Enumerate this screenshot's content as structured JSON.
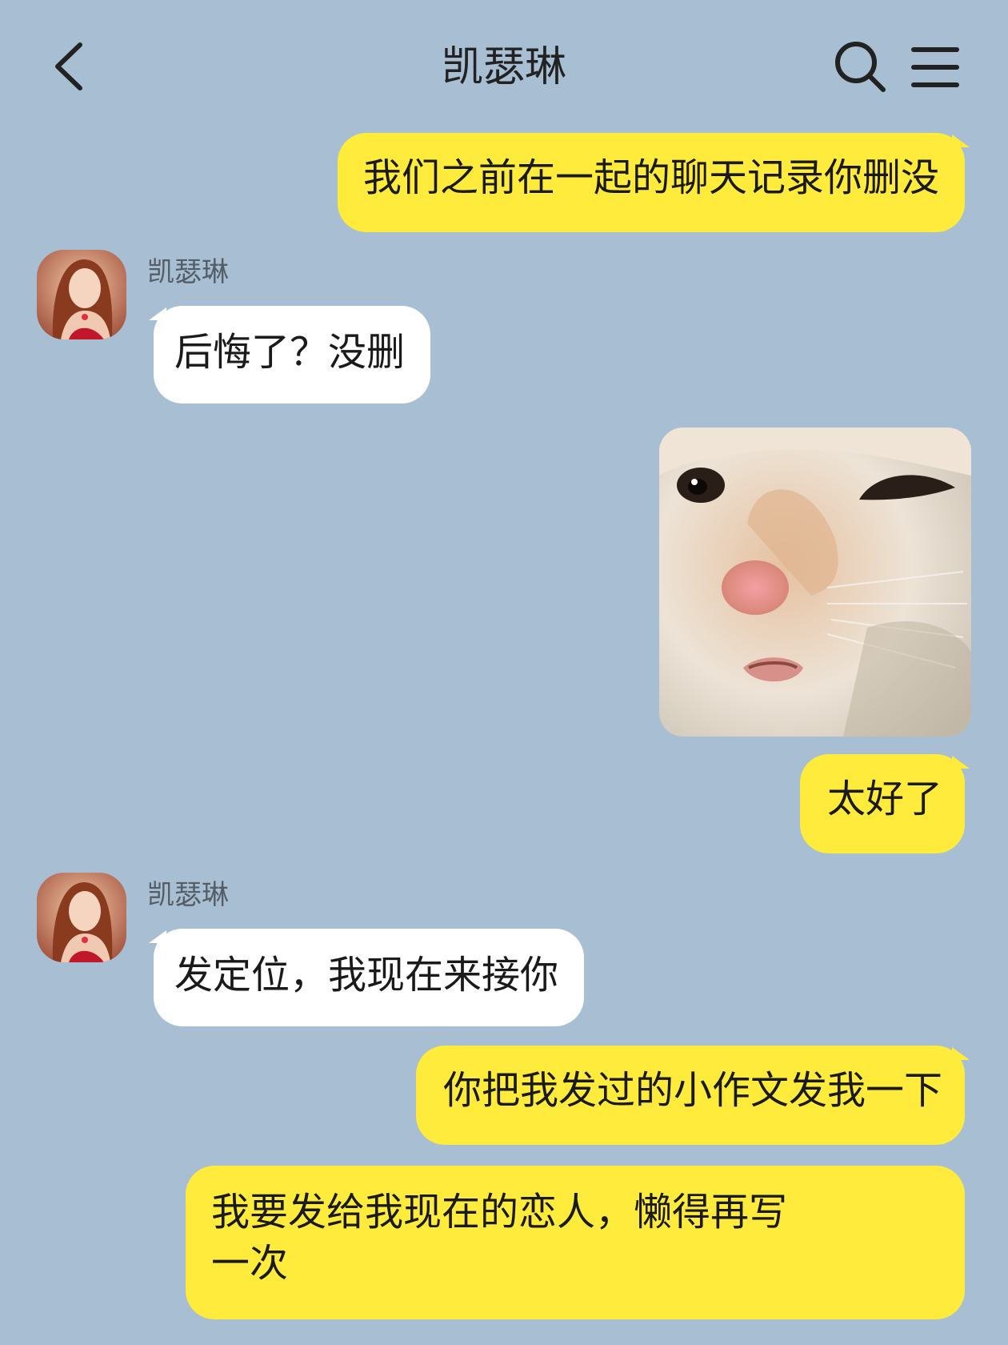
{
  "header": {
    "title": "凯瑟琳",
    "back_icon": "chevron-left-icon",
    "search_icon": "search-icon",
    "menu_icon": "hamburger-menu-icon"
  },
  "messages": [
    {
      "sender": "me",
      "text": "我们之前在一起的聊天记录你删没"
    },
    {
      "sender": "them",
      "name": "凯瑟琳",
      "text": "后悔了？没删"
    },
    {
      "sender": "me",
      "type": "sticker",
      "sticker": "cat-face-sticker"
    },
    {
      "sender": "me",
      "text": "太好了"
    },
    {
      "sender": "them",
      "name": "凯瑟琳",
      "text": "发定位，我现在来接你"
    },
    {
      "sender": "me",
      "text": "你把我发过的小作文发我一下"
    },
    {
      "sender": "me",
      "text_line1": "我要发给我现在的恋人，懒得再写",
      "text_line2": "一次"
    }
  ],
  "colors": {
    "background": "#a8bfd3",
    "my_bubble": "#ffeb3b",
    "their_bubble": "#ffffff"
  }
}
